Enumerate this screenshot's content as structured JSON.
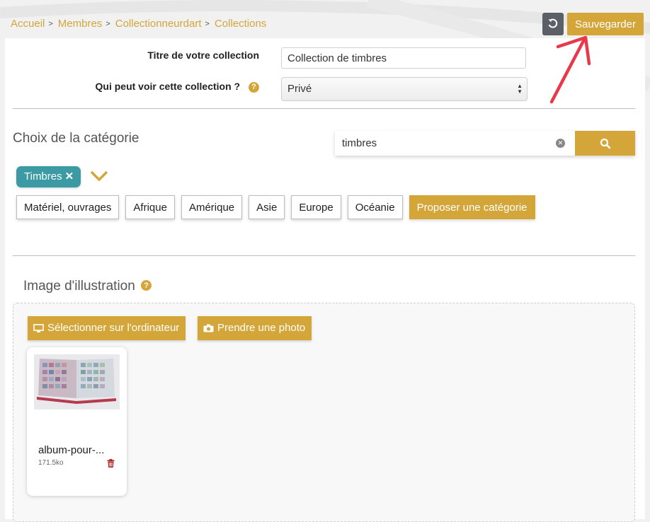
{
  "breadcrumb": {
    "items": [
      "Accueil",
      "Membres",
      "Collectionneurdart",
      "Collections"
    ],
    "separator": ">"
  },
  "toolbar": {
    "reset_icon": "undo-icon",
    "save_label": "Sauvegarder"
  },
  "form": {
    "title_label": "Titre de votre collection",
    "title_value": "Collection de timbres",
    "visibility_label": "Qui peut voir cette collection ?",
    "visibility_value": "Privé"
  },
  "category": {
    "heading": "Choix de la catégorie",
    "search_value": "timbres",
    "selected_tag": "Timbres",
    "subcategories": [
      "Matériel, ouvrages",
      "Afrique",
      "Amérique",
      "Asie",
      "Europe",
      "Océanie"
    ],
    "propose_label": "Proposer une catégorie"
  },
  "illustration": {
    "heading": "Image d'illustration",
    "select_computer_label": "Sélectionner sur l'ordinateur",
    "take_photo_label": "Prendre une photo",
    "file": {
      "name": "album-pour-...",
      "size": "171.5ko"
    }
  },
  "colors": {
    "accent": "#d4a63a",
    "tag": "#3b9aa3",
    "reset_button": "#5b6066",
    "arrow": "#e8394a",
    "trash": "#b22222"
  }
}
